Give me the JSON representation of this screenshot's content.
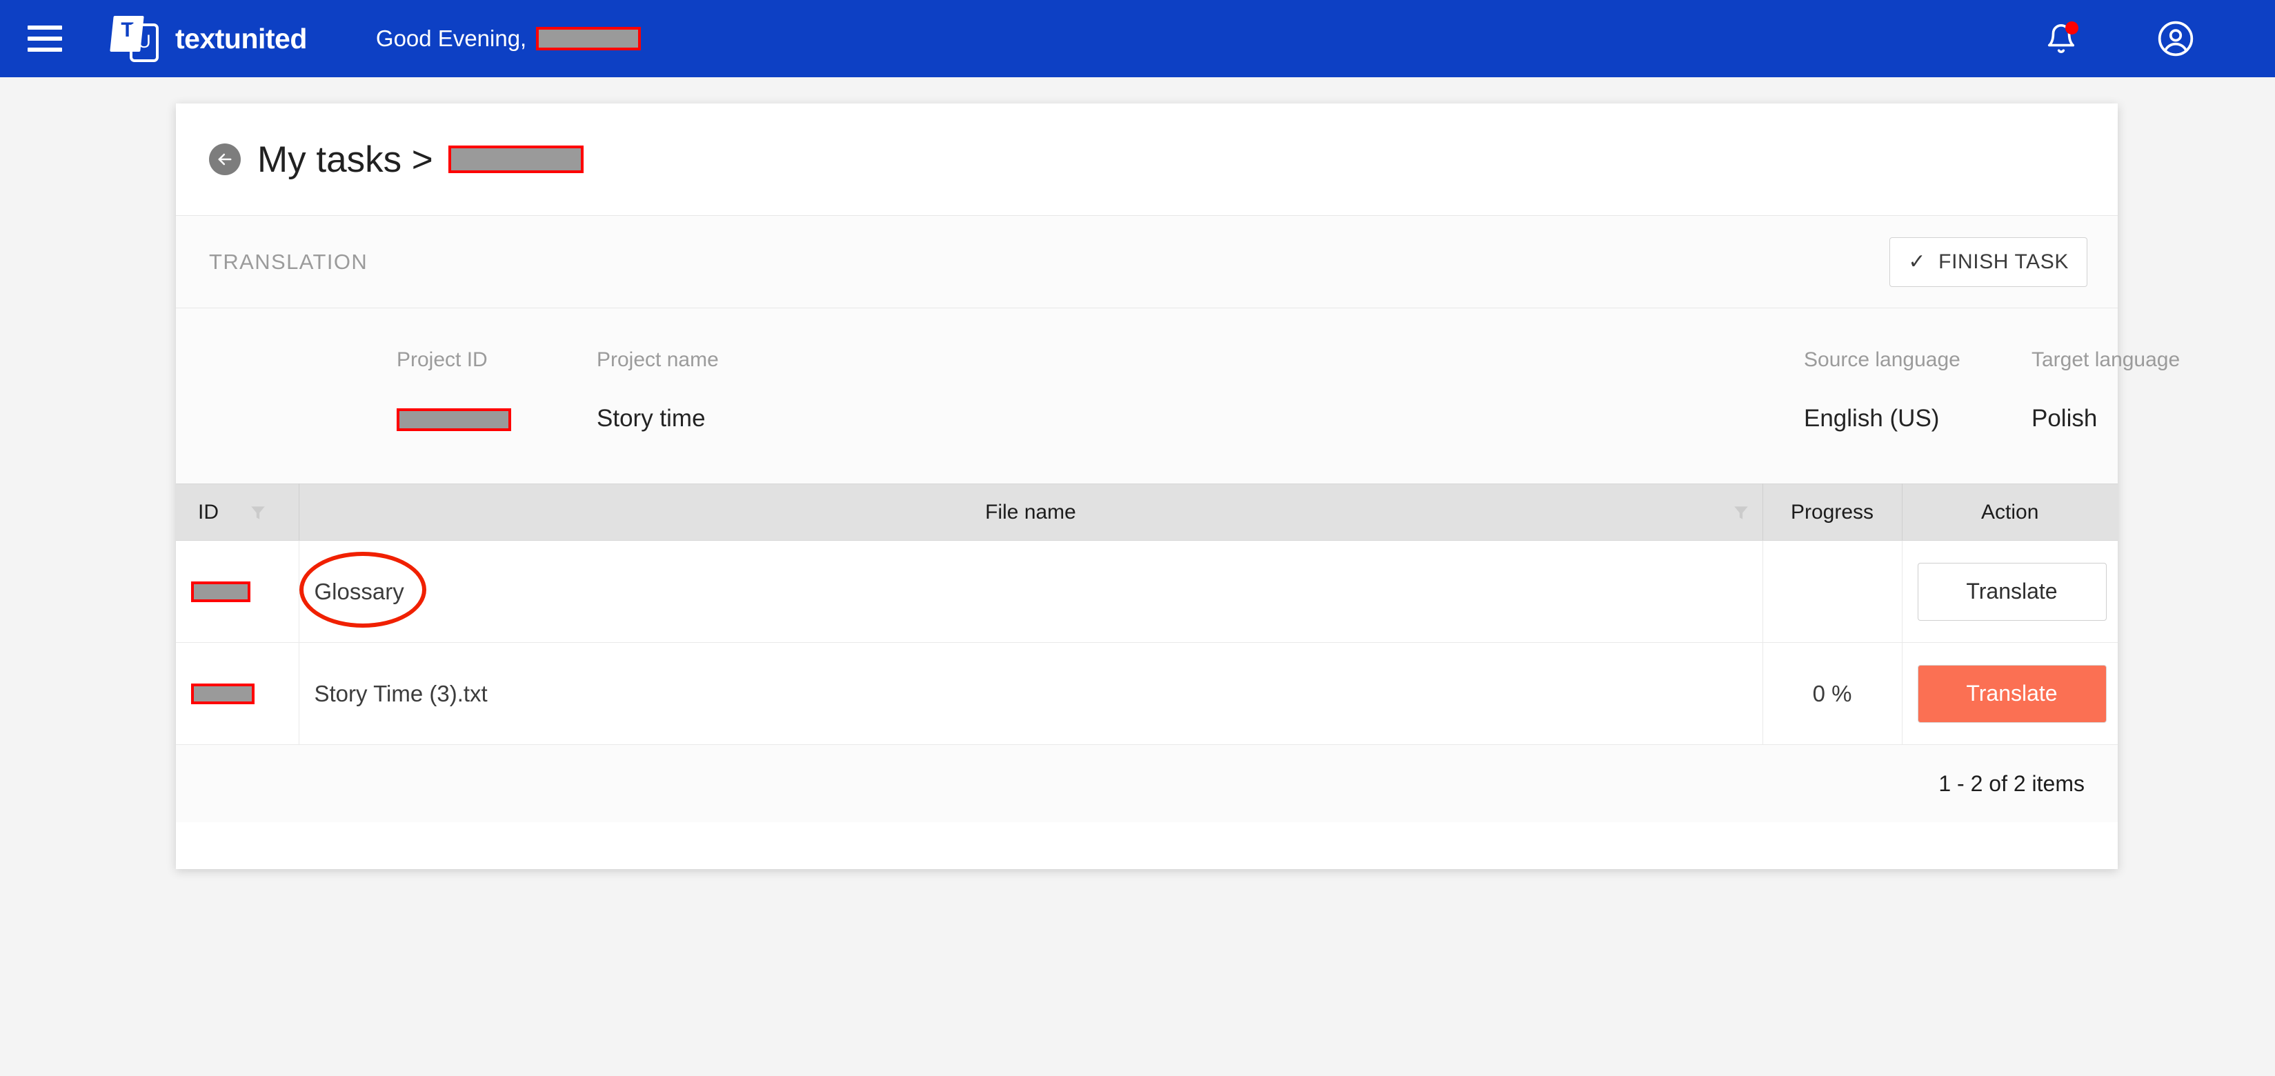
{
  "colors": {
    "brand_blue": "#0d40c4",
    "accent_orange": "#fb7053",
    "redaction_outline": "#ff0000",
    "annotation_red": "#f02000",
    "page_background": "#f4f4f4"
  },
  "topbar": {
    "menu_icon": "hamburger-icon",
    "logo": {
      "left_letter": "T",
      "right_letter": "U"
    },
    "brand_name": "textunited",
    "greeting_text": "Good Evening,",
    "greeting_redacted": true,
    "notifications_icon": "bell-icon",
    "notifications_has_badge": true,
    "account_icon": "user-circle-icon"
  },
  "page": {
    "back_icon": "arrow-left-icon",
    "title": "My tasks >",
    "title_redacted": true
  },
  "section": {
    "label": "TRANSLATION",
    "finish_button": {
      "label": "FINISH TASK",
      "icon": "check-icon"
    }
  },
  "project": {
    "fields": [
      {
        "head": "Project ID",
        "value": "",
        "redacted": true,
        "redact_width": 166
      },
      {
        "head": "Project name",
        "value": "Story time",
        "redacted": false
      },
      {
        "head": "Source language",
        "value": "English (US)",
        "redacted": false
      },
      {
        "head": "Target language",
        "value": "Polish",
        "redacted": false
      }
    ]
  },
  "table": {
    "columns": [
      {
        "label": "ID",
        "filter": true,
        "align": "left"
      },
      {
        "label": "File name",
        "filter": true,
        "align": "center"
      },
      {
        "label": "Progress",
        "filter": false,
        "align": "center"
      },
      {
        "label": "Action",
        "filter": false,
        "align": "center"
      }
    ],
    "rows": [
      {
        "id": "",
        "id_redacted": true,
        "id_redact_width": 86,
        "file_name": "Glossary",
        "progress": "",
        "action_label": "Translate",
        "action_style": "outline",
        "annotated": true
      },
      {
        "id": "",
        "id_redacted": true,
        "id_redact_width": 92,
        "file_name": "Story Time (3).txt",
        "progress": "0 %",
        "action_label": "Translate",
        "action_style": "filled",
        "annotated": false
      }
    ],
    "footer_text": "1 - 2 of 2 items"
  }
}
